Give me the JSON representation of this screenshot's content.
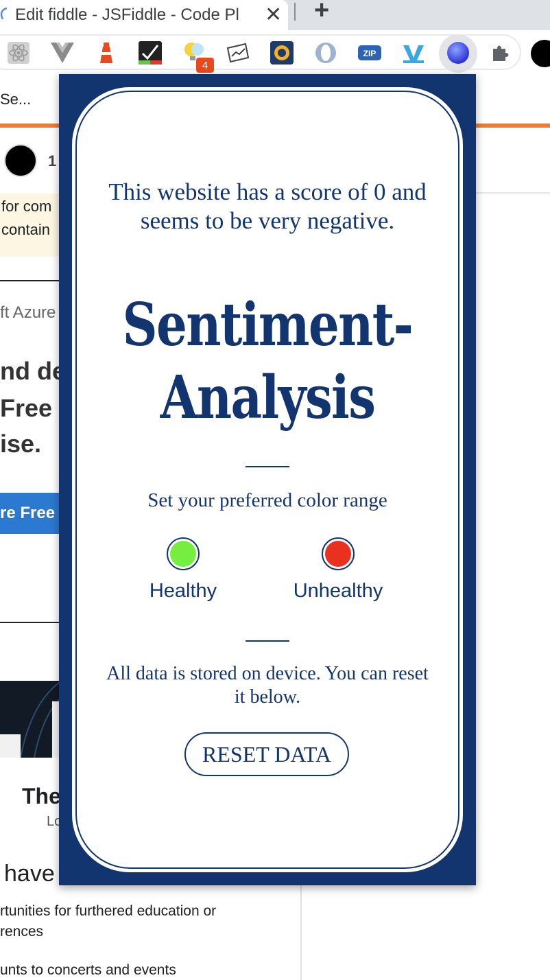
{
  "browser": {
    "tab_title": "Edit fiddle - JSFiddle - Code Pl",
    "tab_close": "✕",
    "new_tab": "+",
    "bookmark_text": "Se...",
    "extension_badge": "4",
    "zip_label": "ZIP"
  },
  "background_page": {
    "number_fragment": "1",
    "notice_line1": "for com",
    "notice_line2": "contain",
    "azure_fragment": "ft Azure",
    "heading_line1": "nd de",
    "heading_line2": "Free u",
    "heading_line3": "ise.",
    "cta_label": "re Free",
    "card_title": "The",
    "card_sub": "Lo",
    "have_text": "have",
    "list_line1": "rtunities for furthered education or",
    "list_line2": "rences",
    "list_line3": "unts to concerts and events"
  },
  "popup": {
    "score_text": "This website has a score of 0 and seems to be very negative.",
    "title_line1": "Sentiment-",
    "title_line2": "Analysis",
    "color_range_label": "Set your preferred color range",
    "healthy_label": "Healthy",
    "unhealthy_label": "Unhealthy",
    "healthy_color": "#76ee3f",
    "unhealthy_color": "#e8321f",
    "storage_note": "All data is stored on device. You can reset it below.",
    "reset_label": "RESET DATA"
  }
}
